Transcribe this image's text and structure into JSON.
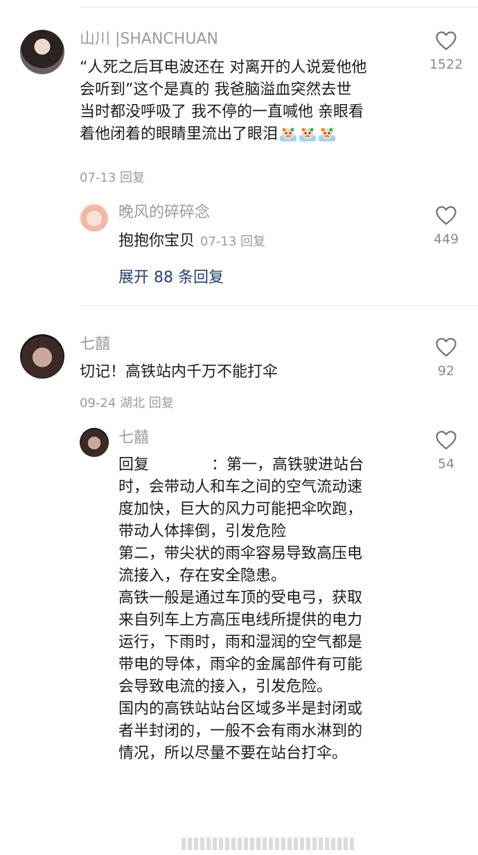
{
  "comments": [
    {
      "username": "山川 |SHANCHUAN",
      "lines": [
        "“人死之后耳电波还在 对离开的人说爱他他",
        "会听到”这个是真的 我爸脑溢血突然去世",
        "当时都没呼吸了 我不停的一直喊他 亲眼看",
        "着他闭着的眼睛里流出了眼泪"
      ],
      "emoji_icon": "crying-face-icon",
      "meta": "07-13 回复",
      "likes": "1522",
      "reply": {
        "username": "晚风的碎碎念",
        "text": "抱抱你宝贝",
        "meta": "07-13 回复",
        "likes": "449"
      },
      "expand_label": "展开 88 条回复"
    },
    {
      "username": "七囍",
      "text": "切记！高铁站内千万不能打伞",
      "meta": "09-24 湖北 回复",
      "likes": "92",
      "reply": {
        "username": "七囍",
        "prefix": "回复",
        "first_line_rest": "：第一，高铁驶进站台",
        "lines": [
          "时，会带动人和车之间的空气流动速",
          "度加快，巨大的风力可能把伞吹跑，",
          "带动人体摔倒，引发危险",
          "第二，带尖状的雨伞容易导致高压电",
          "流接入，存在安全隐患。",
          "高铁一般是通过车顶的受电弓，获取",
          "来自列车上方高压电线所提供的电力",
          "运行，下雨时，雨和湿润的空气都是",
          "带电的导体，雨伞的金属部件有可能",
          "会导致电流的接入，引发危险。",
          "国内的高铁站站台区域多半是封闭或",
          "者半封闭的，一般不会有雨水淋到的",
          "情况，所以尽量不要在站台打伞。"
        ],
        "likes": "54"
      }
    }
  ],
  "icons": {
    "like": "heart-outline-icon"
  },
  "colors": {
    "link": "#27406d",
    "muted": "#9a9a9a"
  }
}
